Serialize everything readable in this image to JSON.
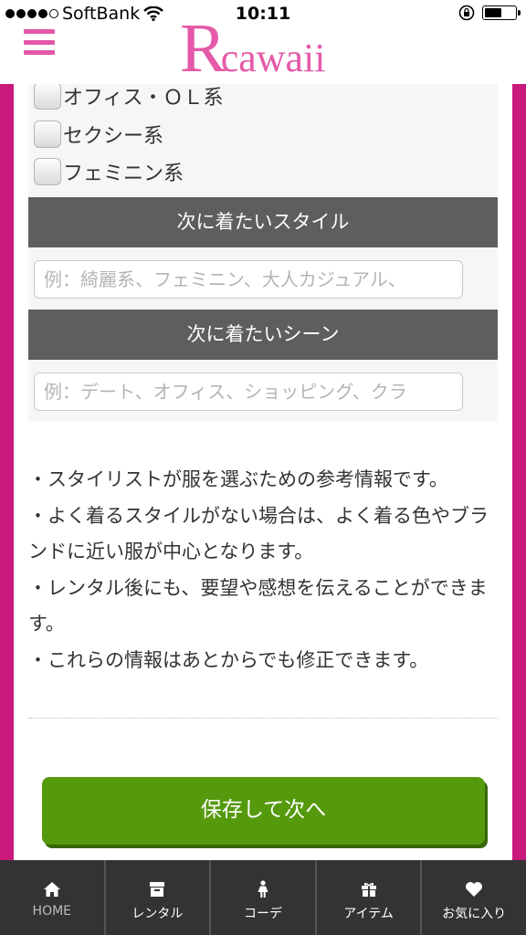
{
  "status_bar": {
    "carrier": "SoftBank",
    "time": "10:11",
    "signal_dots_filled": 4,
    "signal_dots_total": 5,
    "battery_level": 0.6
  },
  "header": {
    "logo_initial": "R",
    "logo_rest": "cawaii",
    "logo_color": "#e45aa9",
    "side_border_color": "#c9197c"
  },
  "style_options": [
    {
      "label": "オフィス・ＯＬ系"
    },
    {
      "label": "セクシー系"
    },
    {
      "label": "フェミニン系"
    }
  ],
  "next_style": {
    "heading": "次に着たいスタイル",
    "placeholder": "例：綺麗系、フェミニン、大人カジュアル、"
  },
  "next_scene": {
    "heading": "次に着たいシーン",
    "placeholder": "例：デート、オフィス、ショッピング、クラ"
  },
  "notes": [
    "・スタイリストが服を選ぶための参考情報です。",
    "・よく着るスタイルがない場合は、よく着る色やブランドに近い服が中心となります。",
    "・レンタル後にも、要望や感想を伝えることができます。",
    "・これらの情報はあとからでも修正できます。"
  ],
  "save_button": {
    "label": "保存して次へ",
    "color": "#55990d"
  },
  "tabbar": {
    "home": "HOME",
    "rental": "レンタル",
    "coordinate": "コーデ",
    "item": "アイテム",
    "favorites": "お気に入り"
  }
}
